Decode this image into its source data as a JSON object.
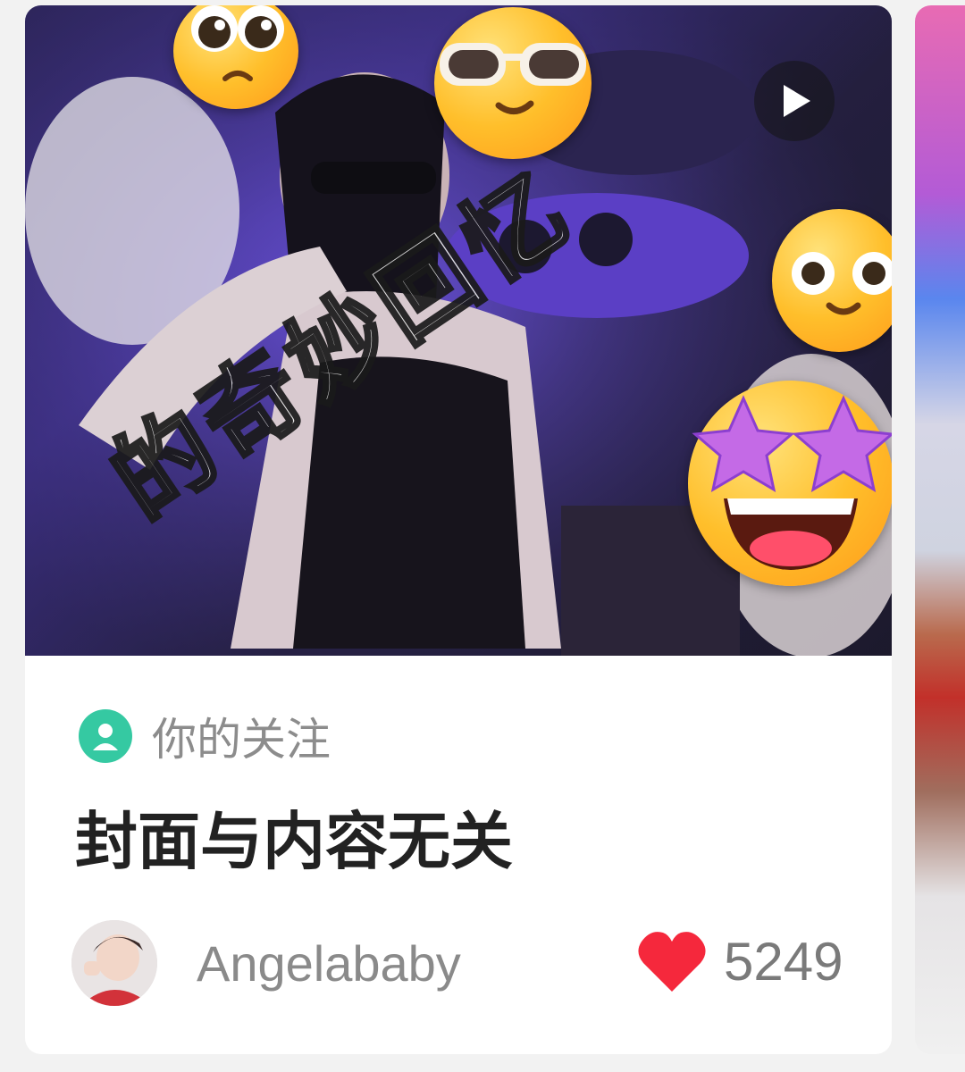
{
  "feed": {
    "card": {
      "cover": {
        "overlay_text": "的奇妙回忆",
        "play_icon": "play-icon",
        "emojis": [
          "pleading-face",
          "sunglasses-face",
          "smiling-face",
          "star-struck-face"
        ]
      },
      "badge": {
        "icon": "person-icon",
        "label": "你的关注"
      },
      "title": "封面与内容无关",
      "author": {
        "name": "Angelababy"
      },
      "likes": {
        "icon": "heart-icon",
        "count": "5249"
      }
    }
  },
  "colors": {
    "badge_green": "#35c9a2",
    "heart_red": "#f5283c",
    "title_text": "#222222",
    "muted_text": "#8c8c8c"
  }
}
